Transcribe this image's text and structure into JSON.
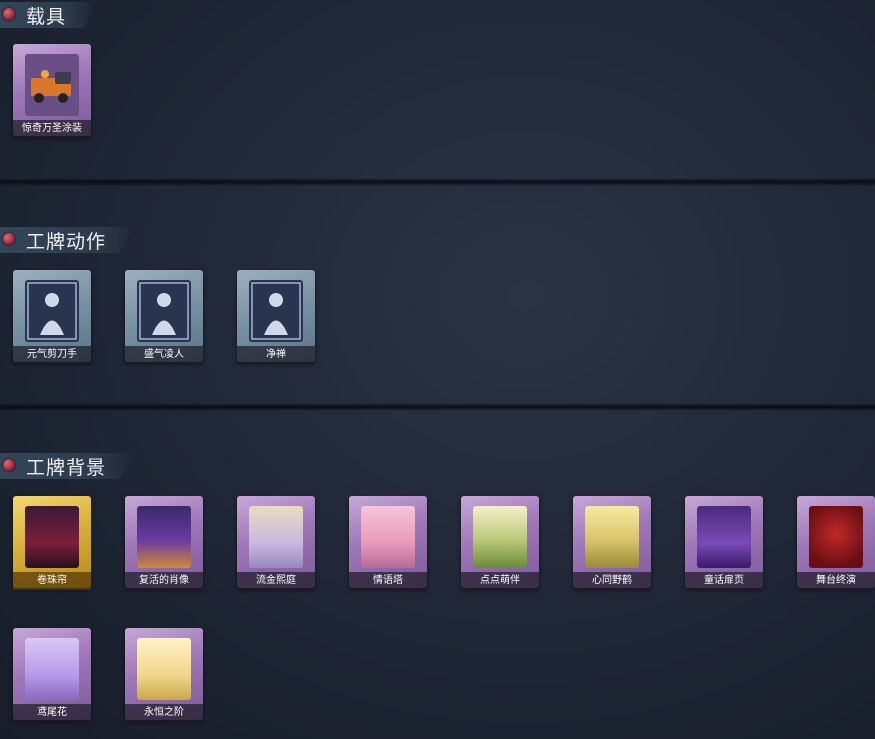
{
  "sections": [
    {
      "title": "载具"
    },
    {
      "title": "工牌动作"
    },
    {
      "title": "工牌背景"
    }
  ],
  "vehicle_items": [
    {
      "label": "惊奇万圣涂装",
      "rarity": "purple"
    }
  ],
  "badge_action_items": [
    {
      "label": "元气剪刀手",
      "rarity": "grey"
    },
    {
      "label": "盛气凌人",
      "rarity": "grey"
    },
    {
      "label": "净禅",
      "rarity": "grey"
    }
  ],
  "badge_bg_items": [
    {
      "label": "卷珠帘",
      "rarity": "gold"
    },
    {
      "label": "复活的肖像",
      "rarity": "purple"
    },
    {
      "label": "流金熙庭",
      "rarity": "purple"
    },
    {
      "label": "情语塔",
      "rarity": "purple"
    },
    {
      "label": "点点萌伴",
      "rarity": "purple"
    },
    {
      "label": "心同野鹤",
      "rarity": "purple"
    },
    {
      "label": "童话扉页",
      "rarity": "purple"
    },
    {
      "label": "舞台终演",
      "rarity": "purple"
    },
    {
      "label": "鸢尾花",
      "rarity": "purple"
    },
    {
      "label": "永恒之阶",
      "rarity": "purple"
    }
  ],
  "colors": {
    "gold": "#d9b036",
    "purple": "#9d76b7",
    "grey": "#7890a3"
  }
}
